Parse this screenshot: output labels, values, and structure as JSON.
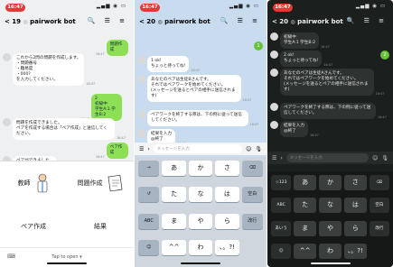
{
  "time": "16:47",
  "status_icons": "▂▄▆ ◉ ▭",
  "side_label": "ジ",
  "p1": {
    "back": "< 19",
    "title": "pairwork bot",
    "header_icons": "🔍 ☰ ≡",
    "messages": [
      {
        "side": "right",
        "text": "問題作成",
        "time": "16:47"
      },
      {
        "side": "left",
        "text": "これから2問の問題を作成します。\n・問題番号\n・難易度\n・000?\nを入力してください。",
        "time": "16:47"
      },
      {
        "side": "right",
        "text": "2\n初級中\n学生A:1 学生B:2",
        "time": "16:47"
      },
      {
        "side": "left",
        "text": "問題を作成できました。\nペアを作成する場合は「ペア作成」と送信してください。",
        "time": "16:47"
      },
      {
        "side": "right",
        "text": "ペア作成",
        "time": "16:47"
      },
      {
        "side": "left",
        "text": "ペアができました。",
        "time": "16:47"
      }
    ],
    "menu": [
      {
        "label": "教師",
        "icon": "teacher-icon"
      },
      {
        "label": "問題作成",
        "icon": "document-icon"
      },
      {
        "label": "ペア作成",
        "icon": ""
      },
      {
        "label": "結果",
        "icon": ""
      }
    ],
    "tap_to_open": "Tap to open ▾"
  },
  "p2": {
    "back": "< 20",
    "title": "pairwork bot",
    "header_icons": "🔍 ☰ ≡",
    "badge": "1",
    "messages": [
      {
        "side": "left",
        "text": "1 ok!\nちょっと待ってね!",
        "time": "16:47"
      },
      {
        "side": "left",
        "text": "あなたのペアは生徒Bさんです。\nそれではペアワークを始めてください。\n(メッセージを送るとペアの相手に送信されます)",
        "time": "16:47"
      },
      {
        "side": "left",
        "text": "ペアワークを終了する際は、下の例に従って送信してください。",
        "time": "16:47"
      },
      {
        "side": "left",
        "text": "結果を入力\n@終了",
        "time": "16:47"
      }
    ],
    "input_placeholder": "メッセージを入力",
    "keys": [
      "→",
      "あ",
      "か",
      "さ",
      "⌫",
      "↺",
      "た",
      "な",
      "は",
      "空白",
      "ABC",
      "ま",
      "や",
      "ら",
      "改行",
      "☺",
      "^^",
      "わ",
      "、。?!"
    ]
  },
  "p3": {
    "back": "< 20",
    "title": "pairwork bot",
    "header_icons": "🔍 ☰ ≡",
    "badge": "2",
    "messages": [
      {
        "side": "left",
        "text": "初級中\n学生A:1 学生B:2",
        "time": "16:47"
      },
      {
        "side": "left",
        "text": "2 ok!\nちょっと待ってね!",
        "time": "16:47"
      },
      {
        "side": "left",
        "text": "あなたのペアは生徒Aさんです。\nそれではペアワークを始めてください。\n(メッセージを送るとペアの相手に送信されます)",
        "time": "16:47"
      },
      {
        "side": "left",
        "text": "ペアワークを終了する際は、下の例に従って送信してください。",
        "time": "16:47"
      },
      {
        "side": "left",
        "text": "結果を入力\n@終了",
        "time": "16:47"
      }
    ],
    "input_placeholder": "メッセージを入力",
    "keys": [
      "☆123",
      "あ",
      "か",
      "さ",
      "⌫",
      "ABC",
      "た",
      "な",
      "は",
      "空白",
      "あいう",
      "ま",
      "や",
      "ら",
      "改行",
      "☺",
      "^^",
      "わ",
      "、。?!"
    ]
  }
}
